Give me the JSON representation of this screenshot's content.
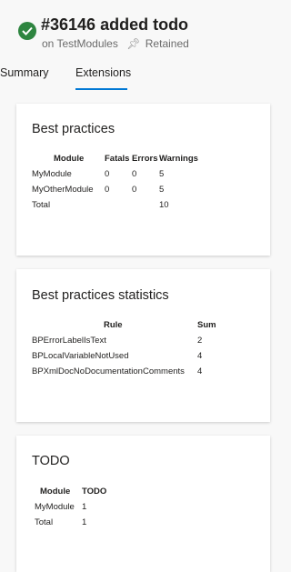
{
  "header": {
    "title": "#36146 added todo",
    "on_label": "on TestModules",
    "retained_label": "Retained",
    "status": "succeeded",
    "status_icon": "check-circle-icon",
    "status_color": "#2e8540"
  },
  "tabs": [
    {
      "label": "Summary",
      "selected": false
    },
    {
      "label": "Extensions",
      "selected": true
    }
  ],
  "accent_color": "#0078d4",
  "cards": {
    "best_practices": {
      "title": "Best practices",
      "headers": [
        "Module",
        "Fatals",
        "Errors",
        "Warnings"
      ],
      "rows": [
        [
          "MyModule",
          "0",
          "0",
          "5"
        ],
        [
          "MyOtherModule",
          "0",
          "0",
          "5"
        ],
        [
          "Total",
          "",
          "",
          "10"
        ]
      ]
    },
    "statistics": {
      "title": "Best practices statistics",
      "headers": [
        "Rule",
        "Sum"
      ],
      "rows": [
        [
          "BPErrorLabelIsText",
          "2"
        ],
        [
          "BPLocalVariableNotUsed",
          "4"
        ],
        [
          "BPXmlDocNoDocumentationComments",
          "4"
        ]
      ]
    },
    "todo": {
      "title": "TODO",
      "headers": [
        "Module",
        "TODO"
      ],
      "rows": [
        [
          "MyModule",
          "1"
        ],
        [
          "Total",
          "1"
        ]
      ]
    }
  }
}
